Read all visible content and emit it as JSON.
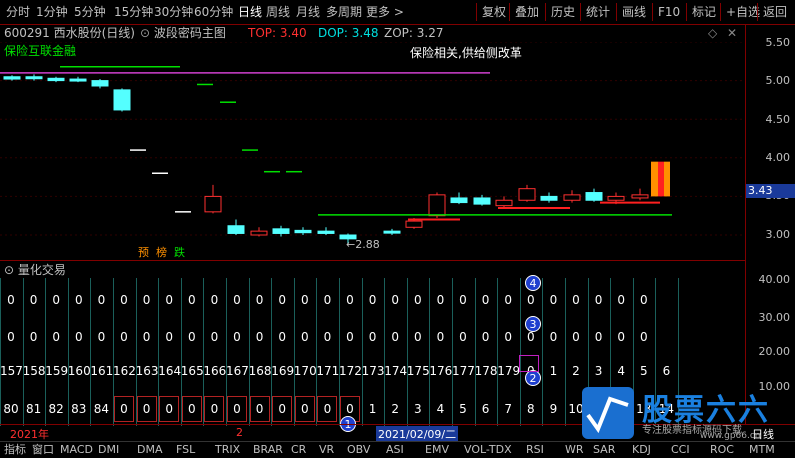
{
  "toolbar": {
    "periods": [
      "分时",
      "1分钟",
      "5分钟",
      "15分钟",
      "30分钟",
      "60分钟",
      "日线",
      "周线",
      "月线",
      "多周期",
      "更多 >"
    ],
    "active": "日线",
    "right": [
      "复权",
      "叠加",
      "历史",
      "统计",
      "画线",
      "F10",
      "标记",
      "+自选",
      "返回"
    ]
  },
  "info": {
    "code": "600291 西水股份(日线)",
    "indicator": "波段密码主图",
    "top": "TOP: 3.40",
    "dop": "DOP: 3.48",
    "zop": "ZOP: 3.27",
    "sector": "保险互联金融",
    "note": "保险相关,供给侧改革"
  },
  "chart_data": {
    "type": "candlestick",
    "y_ticks": [
      "5.50",
      "5.00",
      "4.50",
      "4.00",
      "3.50",
      "3.00"
    ],
    "current_price": "3.43",
    "low_label": "2.88",
    "tags": [
      "预",
      "榜",
      "跌"
    ]
  },
  "quant": {
    "title": "量化交易",
    "y_ticks": [
      "40.00",
      "30.00",
      "20.00",
      "10.00"
    ],
    "row1": [
      "0",
      "0",
      "0",
      "0",
      "0",
      "0",
      "0",
      "0",
      "0",
      "0",
      "0",
      "0",
      "0",
      "0",
      "0",
      "0",
      "0",
      "0",
      "0",
      "0",
      "0",
      "0",
      "0",
      "0",
      "0",
      "0",
      "0",
      "0",
      "0"
    ],
    "row2": [
      "0",
      "0",
      "0",
      "0",
      "0",
      "0",
      "0",
      "0",
      "0",
      "0",
      "0",
      "0",
      "0",
      "0",
      "0",
      "0",
      "0",
      "0",
      "0",
      "0",
      "0",
      "0",
      "0",
      "0",
      "0",
      "0",
      "0",
      "0",
      "0"
    ],
    "row3": [
      "157",
      "158",
      "159",
      "160",
      "161",
      "162",
      "163",
      "164",
      "165",
      "166",
      "167",
      "168",
      "169",
      "170",
      "171",
      "172",
      "173",
      "174",
      "175",
      "176",
      "177",
      "178",
      "179",
      "0",
      "1",
      "2",
      "3",
      "4",
      "5",
      "6"
    ],
    "row4": [
      "80",
      "81",
      "82",
      "83",
      "84",
      "0",
      "0",
      "0",
      "0",
      "0",
      "0",
      "0",
      "0",
      "0",
      "0",
      "0",
      "1",
      "2",
      "3",
      "4",
      "5",
      "6",
      "7",
      "8",
      "9",
      "10",
      "11",
      "12",
      "13",
      "14"
    ],
    "markers": [
      "1",
      "2",
      "3",
      "4"
    ]
  },
  "dates": {
    "year": "2021年",
    "month": "2",
    "selected": "2021/02/09/二",
    "period": "日线"
  },
  "bottombar": [
    "指标",
    "窗口",
    "MACD",
    "DMI",
    "DMA",
    "FSL",
    "TRIX",
    "BRAR",
    "CR",
    "VR",
    "OBV",
    "ASI",
    "EMV",
    "VOL-TDX",
    "RSI",
    "WR",
    "SAR",
    "KDJ",
    "CCI",
    "ROC",
    "MTM"
  ],
  "logo": {
    "name": "股票六六",
    "sub": "专注股票指标源码下载",
    "url": "www.gp66.cn"
  }
}
